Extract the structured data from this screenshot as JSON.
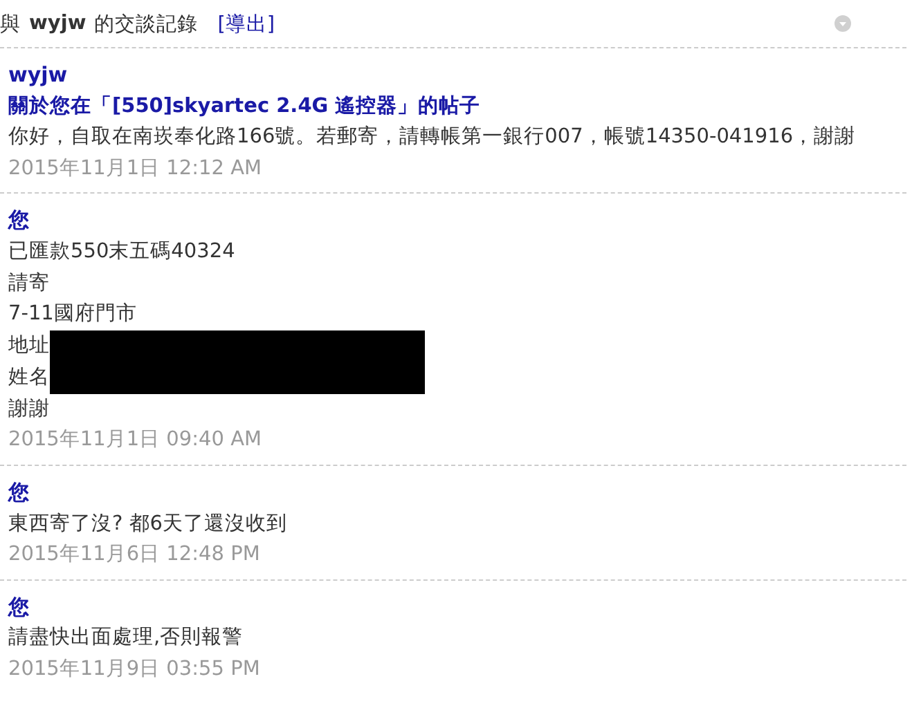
{
  "header": {
    "prefix": "與",
    "name": "wyjw",
    "suffix": "的交談記錄",
    "export_link": "[導出]"
  },
  "messages": [
    {
      "sender": "wyjw",
      "subject": "關於您在「[550]skyartec 2.4G 遙控器」的帖子",
      "lines": [
        {
          "text": "你好，自取在南崁奉化路166號。若郵寄，請轉帳第一銀行007，帳號14350-041916，謝謝",
          "redacted": false
        }
      ],
      "time": "2015年11月1日 12:12 AM"
    },
    {
      "sender": "您",
      "lines": [
        {
          "text": "已匯款550末五碼40324",
          "redacted": false
        },
        {
          "text": "請寄",
          "redacted": false
        },
        {
          "text": "7-11國府門市",
          "redacted": false
        },
        {
          "text": "地址",
          "redacted": true
        },
        {
          "text": "姓名",
          "redacted": true
        },
        {
          "text": "謝謝",
          "redacted": false
        }
      ],
      "time": "2015年11月1日 09:40 AM"
    },
    {
      "sender": "您",
      "lines": [
        {
          "text": "東西寄了沒? 都6天了還沒收到",
          "redacted": false
        }
      ],
      "time": "2015年11月6日 12:48 PM"
    },
    {
      "sender": "您",
      "lines": [
        {
          "text": "請盡快出面處理,否則報警",
          "redacted": false
        }
      ],
      "time": "2015年11月9日 03:55 PM"
    }
  ]
}
